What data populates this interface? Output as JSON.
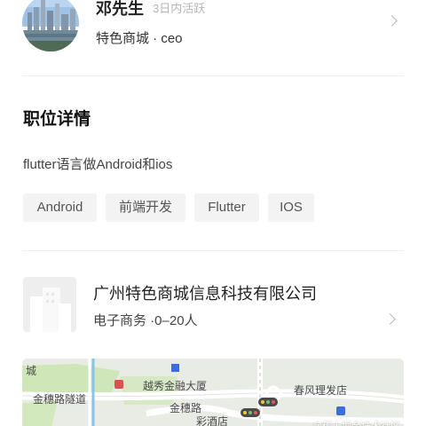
{
  "recruiter": {
    "name": "邓先生",
    "active_status": "3日内活跃",
    "company_title": "特色商城 · ceo"
  },
  "job": {
    "section_title": "职位详情",
    "description": "flutter语言做Android和ios",
    "tags": [
      "Android",
      "前端开发",
      "Flutter",
      "IOS"
    ]
  },
  "company": {
    "name": "广州特色商城信息科技有限公司",
    "info": "电子商务 ·0–20人"
  },
  "map": {
    "labels": {
      "city_fragment": "城",
      "road_1": "金穗路隧道",
      "building": "越秀金融大厦",
      "road_2": "金穗路",
      "hotel_fragment": "彩酒店",
      "shop": "春风理发店"
    }
  },
  "watermark": "@稀土掘金技术社区"
}
